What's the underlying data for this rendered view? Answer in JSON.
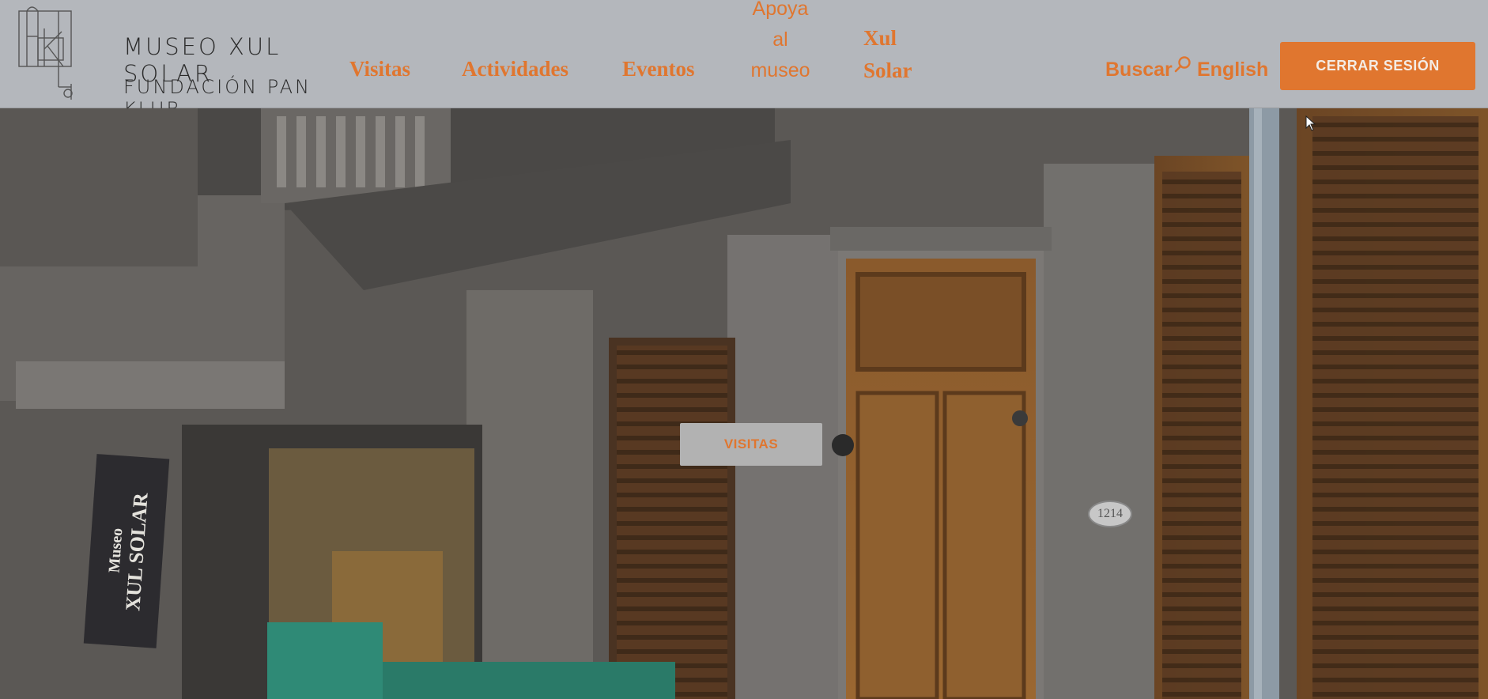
{
  "header": {
    "logo": {
      "line1": "MUSEO XUL SOLAR",
      "line2": "FUNDACIÓN PAN KLUB"
    },
    "nav": [
      {
        "label": "Visitas"
      },
      {
        "label": "Actividades"
      },
      {
        "label": "Eventos"
      },
      {
        "label_lines": [
          "Apoya",
          "al",
          "museo"
        ]
      },
      {
        "label_lines": [
          "Xul",
          "Solar"
        ]
      }
    ],
    "search_label": "Buscar",
    "language_label": "English",
    "logout_label": "CERRAR SESIÓN"
  },
  "hero": {
    "button_label": "VISITAS",
    "sign_text": [
      "Museo",
      "XUL SOLAR"
    ],
    "door_number": "1214"
  },
  "colors": {
    "accent": "#e0762f",
    "header_bg": "#b4b7bc"
  }
}
